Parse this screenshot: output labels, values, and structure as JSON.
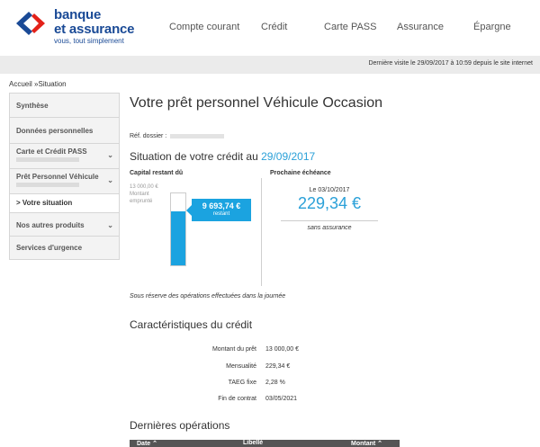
{
  "header": {
    "logo": {
      "line1": "banque",
      "line2": "et assurance",
      "tagline": "vous, tout simplement"
    },
    "nav": [
      "Compte courant",
      "Crédit",
      "Carte PASS",
      "Assurance",
      "Épargne"
    ]
  },
  "visit": {
    "text": "Dernière visite le 29/09/2017 à 10:59 depuis le site internet"
  },
  "breadcrumb": {
    "home": "Accueil",
    "separator": "»",
    "current": "Situation"
  },
  "sidebar": {
    "items": [
      {
        "label": "Synthèse"
      },
      {
        "label": "Données personnelles"
      },
      {
        "label": "Carte et Crédit PASS"
      },
      {
        "label": "Prêt Personnel Véhicule"
      },
      {
        "label": "Nos autres produits"
      },
      {
        "label": "Services d'urgence"
      }
    ],
    "sub": {
      "marker": ">",
      "label": "Votre situation"
    },
    "chevron": "⌄"
  },
  "main": {
    "title": "Votre prêt personnel Véhicule Occasion",
    "ref_label": "Réf. dossier :",
    "situation_prefix": "Situation de votre crédit au",
    "situation_date": "29/09/2017",
    "capital_label": "Capital restant dû",
    "capital_total": "13 000,00 €",
    "capital_total_note": "Montant emprunté",
    "capital_remaining": "9 693,74 €",
    "capital_remaining_label": "restant",
    "capital_ratio": 0.7457,
    "due_label": "Prochaine échéance",
    "due_date": "Le 03/10/2017",
    "due_amount": "229,34 €",
    "due_note": "sans assurance",
    "reserve_note": "Sous réserve des opérations effectuées dans la journée",
    "features_title": "Caractéristiques du crédit",
    "features": [
      {
        "label": "Montant du prêt",
        "value": "13 000,00 €"
      },
      {
        "label": "Mensualité",
        "value": "229,34 €"
      },
      {
        "label": "TAEG fixe",
        "value": "2,28 %"
      },
      {
        "label": "Fin de contrat",
        "value": "03/05/2021"
      }
    ],
    "ops_title": "Dernières opérations",
    "ops_headers": [
      "Date ⌃",
      "Libellé",
      "Montant ⌃"
    ]
  },
  "colors": {
    "accent": "#1ba3e0",
    "brand": "#1a4a96",
    "red": "#e32119"
  }
}
